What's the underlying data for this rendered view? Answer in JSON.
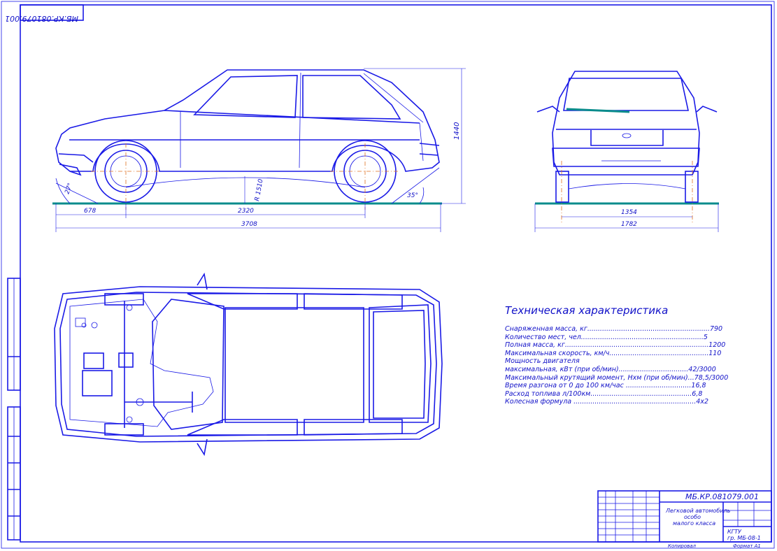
{
  "drawing": {
    "code_top_left": "МБ.КР.081079.001",
    "side_view": {
      "height_label": "1440",
      "clearance_label": "R 1510",
      "approach_angle": "27°",
      "departure_angle": "35°",
      "front_overhang": "678",
      "wheelbase": "2320",
      "total_length": "3708"
    },
    "rear_view": {
      "track": "1354",
      "total_width": "1782"
    }
  },
  "specs": {
    "title": "Техническая характеристика",
    "rows": [
      "Снаряженная масса, кг..........................................................790",
      "Количество мест, чел..........................................................5",
      "Полная масса, кг....................................................................1200",
      "Максимальная скорость, км/ч...............................................110",
      "Мощность двигателя",
      "максимальная, кВт (при об/мин).................................42/3000",
      "Максимальный крутящий момент, Нхм (при об/мин)...78,5/3000",
      "Время разгона от 0 до 100 км/час ...............................16,8",
      "Расход топлива л/100км................................................6,8",
      "Колесная формула ..........................................................4х2"
    ]
  },
  "title_block": {
    "doc_code": "МБ.КР.081079.001",
    "name_line1": "Легковой автомобиль",
    "name_line2": "особо",
    "name_line3": "малого класса",
    "org_line1": "КГТУ",
    "org_line2": "гр. МБ-08-1",
    "copied_label": "Копировал",
    "format_label": "Формат  А1"
  }
}
